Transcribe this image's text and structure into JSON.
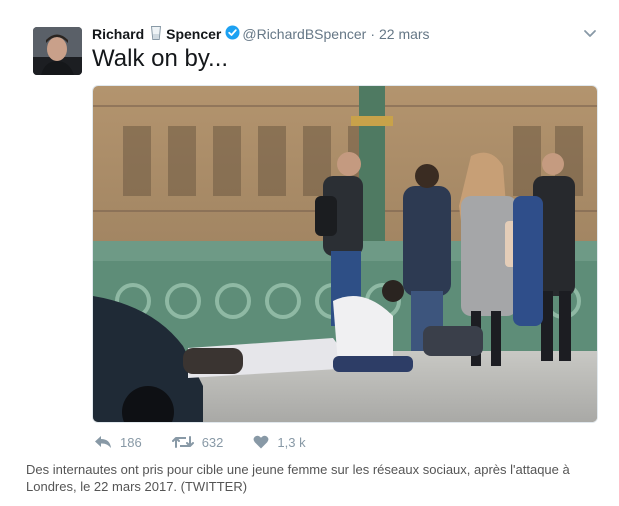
{
  "tweet": {
    "name_first": "Richard",
    "name_last": "Spencer",
    "handle": "@RichardBSpencer",
    "separator": "·",
    "time": "22 mars",
    "text": "Walk on by...",
    "actions": {
      "reply_count": "186",
      "retweet_count": "632",
      "like_count": "1,3 k"
    }
  },
  "caption": "Des internautes ont pris pour cible une jeune femme sur les réseaux sociaux, après l'attaque à Londres, le 22 mars 2017. (TWITTER)",
  "colors": {
    "verified": "#1da1f2",
    "action_gray": "#8899a6",
    "handle_gray": "#657786"
  },
  "icons": [
    "glass-icon",
    "verified-badge-icon",
    "chevron-down-icon",
    "reply-icon",
    "retweet-icon",
    "heart-icon"
  ]
}
